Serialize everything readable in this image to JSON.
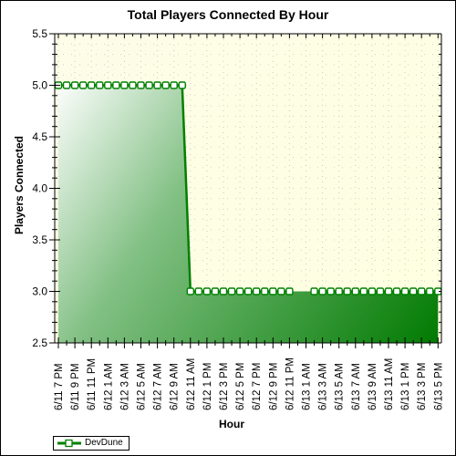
{
  "chart_data": {
    "type": "area",
    "title": "Total Players Connected By Hour",
    "xlabel": "Hour",
    "ylabel": "Players Connected",
    "ylim": [
      2.5,
      5.5
    ],
    "yticks": [
      "2.5",
      "3.0",
      "3.5",
      "4.0",
      "4.5",
      "5.0",
      "5.5"
    ],
    "yticks_values": [
      2.5,
      3.0,
      3.5,
      4.0,
      4.5,
      5.0,
      5.5
    ],
    "x_labels": [
      "6/11 7 PM",
      "6/11 9 PM",
      "6/11 11 PM",
      "6/12 1 AM",
      "6/12 3 AM",
      "6/12 5 AM",
      "6/12 7 AM",
      "6/12 9 AM",
      "6/12 11 AM",
      "6/12 1 PM",
      "6/12 3 PM",
      "6/12 5 PM",
      "6/12 7 PM",
      "6/12 9 PM",
      "6/12 11 PM",
      "6/13 1 AM",
      "6/13 3 AM",
      "6/13 5 AM",
      "6/13 7 AM",
      "6/13 9 AM",
      "6/13 11 AM",
      "6/13 1 PM",
      "6/13 3 PM",
      "6/13 5 PM"
    ],
    "x_hour_count": 47,
    "grid": true,
    "legend_position": "bottom-left",
    "series": [
      {
        "name": "DevDune",
        "color": "#008000",
        "hour_index": [
          0,
          1,
          2,
          3,
          4,
          5,
          6,
          7,
          8,
          9,
          10,
          11,
          12,
          13,
          14,
          15,
          16,
          17,
          18,
          19,
          20,
          21,
          22,
          23,
          24,
          25,
          26,
          27,
          28,
          31,
          32,
          33,
          34,
          35,
          36,
          37,
          38,
          39,
          40,
          41,
          42,
          43,
          44,
          45,
          46
        ],
        "values": [
          5,
          5,
          5,
          5,
          5,
          5,
          5,
          5,
          5,
          5,
          5,
          5,
          5,
          5,
          5,
          5,
          3,
          3,
          3,
          3,
          3,
          3,
          3,
          3,
          3,
          3,
          3,
          3,
          3,
          3,
          3,
          3,
          3,
          3,
          3,
          3,
          3,
          3,
          3,
          3,
          3,
          3,
          3,
          3,
          3
        ]
      }
    ]
  },
  "colors": {
    "plot_bg": "#ffffe0",
    "series": "#008000"
  }
}
